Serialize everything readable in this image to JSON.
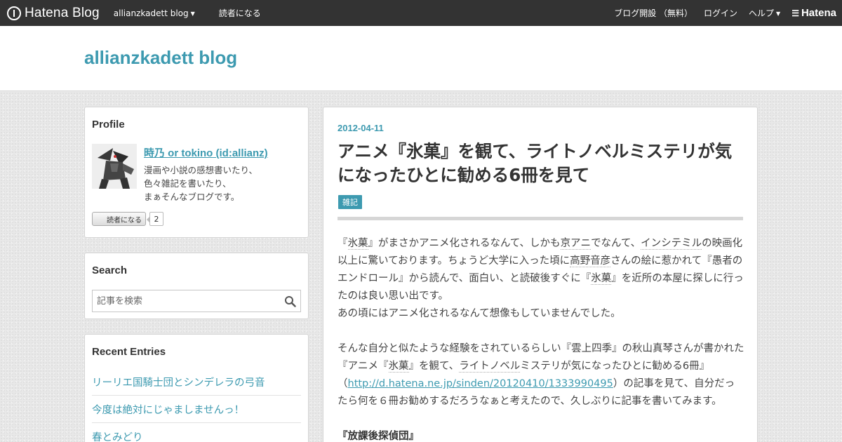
{
  "topbar": {
    "logo_text": "Hatena Blog",
    "blog_menu_label": "allianzkadett blog",
    "subscribe_label": "読者になる",
    "open_blog_label": "ブログ開設 （無料）",
    "login_label": "ログイン",
    "help_label": "ヘルプ",
    "brand_label": "Hatena"
  },
  "header": {
    "blog_title": "allianzkadett blog"
  },
  "profile": {
    "title": "Profile",
    "name": "時乃 or tokino (id:allianz)",
    "desc_lines": [
      "漫画や小説の感想書いたり、",
      "色々雑記を書いたり、",
      "まぁそんなブログです。"
    ],
    "subscribe_button": "読者になる",
    "subscriber_count": "2"
  },
  "search": {
    "title": "Search",
    "placeholder": "記事を検索"
  },
  "recent": {
    "title": "Recent Entries",
    "items": [
      "リーリエ国騎士団とシンデレラの弓音",
      "今度は絶対にじゃましませんっ！",
      "春とみどり"
    ]
  },
  "article": {
    "date": "2012-04-11",
    "title": "アニメ『氷菓』を観て、ライトノベルミステリが気になったひとに勧める6冊を見て",
    "category": "雑記",
    "p1": {
      "s1": "『",
      "k1": "氷菓",
      "s2": "』がまさかアニメ化されるなんて、しかも",
      "k2": "京アニ",
      "s3": "でなんて、",
      "k3": "インシテミル",
      "s4": "の映画化以上に驚いております。ちょうど大学に入った頃に",
      "k4": "高野音彦",
      "s5": "さんの絵に惹かれて『愚者のエンドロール』から読んで、面白い、と読破後すぐに『",
      "k5": "氷菓",
      "s6": "』を近所の本屋に探しに行ったのは良い思い出です。",
      "s7": "あの頃にはアニメ化されるなんて想像もしていませんでした。"
    },
    "p2": {
      "s1": "そんな自分と似たような経験をされているらしい『雲上四季』の秋山真琴さんが書かれた『アニメ『",
      "k1": "氷菓",
      "s2": "』を観て、",
      "k2": "ライトノベル",
      "s3": "ミステリが気になったひとに勧める6冊』（",
      "link": "http://d.hatena.ne.jp/sinden/20120410/1333990495",
      "s4": "）の記事を見て、自分だったら何を６冊お勧めするだろうなぁと考えたので、久しぶりに記事を書いてみます。"
    },
    "section_head": "『放課後探偵団』"
  },
  "colors": {
    "accent": "#3d9ab0",
    "topbar_bg": "#333333",
    "background": "#ececec"
  }
}
